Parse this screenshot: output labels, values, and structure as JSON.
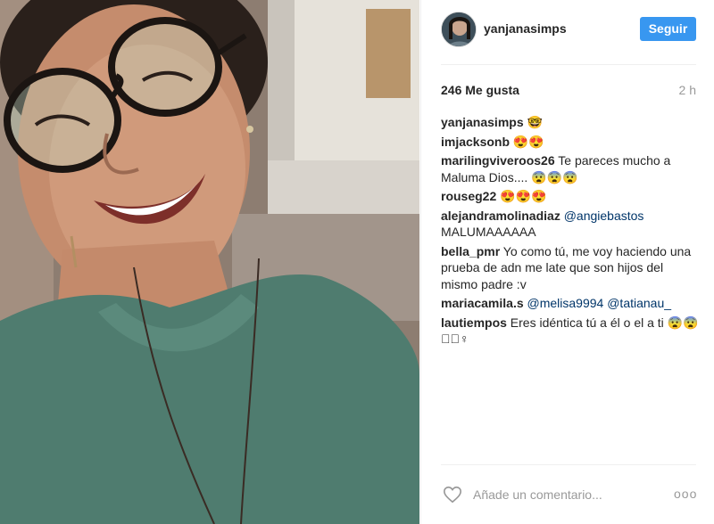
{
  "post": {
    "username": "yanjanasimps",
    "follow_label": "Seguir",
    "likes": "246 Me gusta",
    "time": "2 h"
  },
  "comments": [
    {
      "user": "yanjanasimps",
      "text": " 🤓"
    },
    {
      "user": "imjacksonb",
      "text": " 😍😍"
    },
    {
      "user": "marilingviveroos26",
      "text": " Te pareces mucho a Maluma Dios.... 😨😨😨"
    },
    {
      "user": "rouseg22",
      "text": " 😍😍😍"
    },
    {
      "user": "alejandramolinadiaz",
      "mention": "@angiebastos",
      "text": " MALUMAAAAAA"
    },
    {
      "user": "bella_pmr",
      "text": " Yo como tú, me voy haciendo una prueba de adn me late que son hijos del mismo padre :v"
    },
    {
      "user": "mariacamila.s",
      "mention": "@melisa9994",
      "mention2": "@tatianau_",
      "text": ""
    },
    {
      "user": "lautiempos",
      "text": " Eres idéntica tú a él o el a ti 😨😨◻🏽♀"
    }
  ],
  "footer": {
    "comment_placeholder": "Añade un comentario...",
    "more_label": "ooo"
  },
  "icons": {
    "heart": "heart-icon",
    "avatar": "avatar",
    "more": "more-options-icon"
  },
  "colors": {
    "follow_button": "#3897f0",
    "mention": "#003569",
    "muted": "#999999",
    "shirt": "#4f7c6f"
  }
}
